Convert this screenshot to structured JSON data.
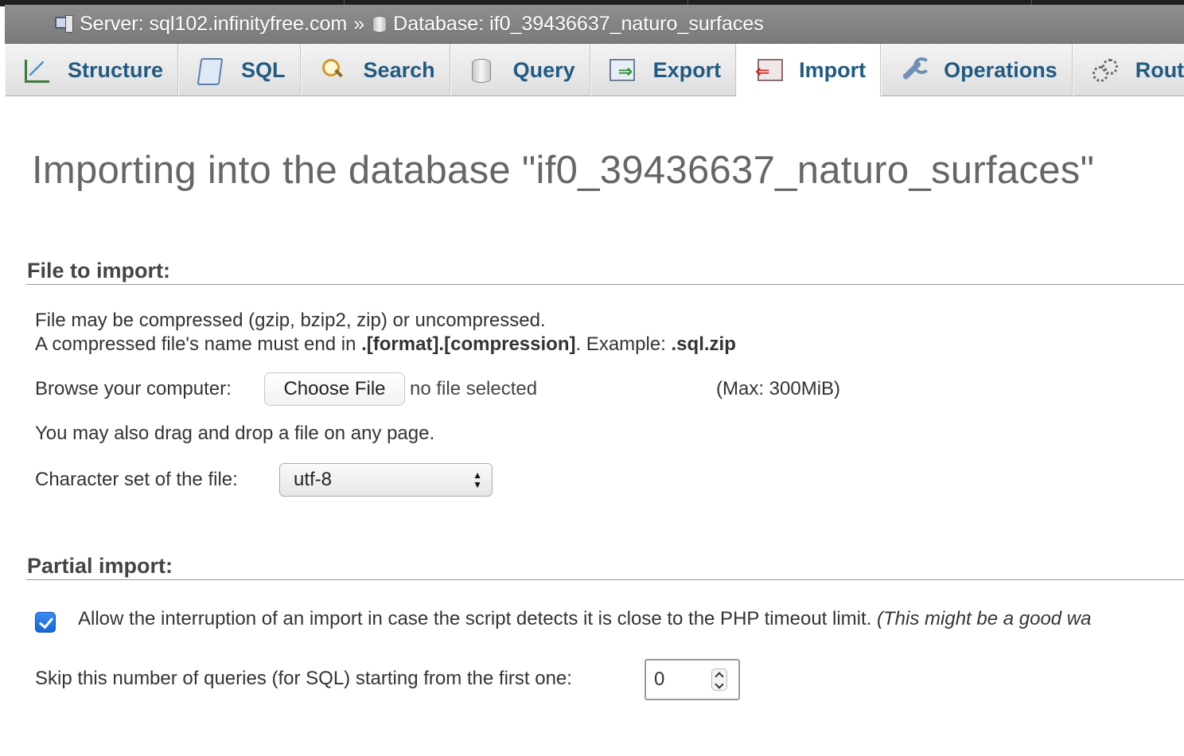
{
  "breadcrumb": {
    "server_label": "Server: sql102.infinityfree.com",
    "separator": "»",
    "database_label": "Database: if0_39436637_naturo_surfaces"
  },
  "tabs": [
    {
      "label": "Structure",
      "icon": "structure-icon",
      "active": false
    },
    {
      "label": "SQL",
      "icon": "sql-icon",
      "active": false
    },
    {
      "label": "Search",
      "icon": "search-icon",
      "active": false
    },
    {
      "label": "Query",
      "icon": "query-icon",
      "active": false
    },
    {
      "label": "Export",
      "icon": "export-icon",
      "active": false
    },
    {
      "label": "Import",
      "icon": "import-icon",
      "active": true
    },
    {
      "label": "Operations",
      "icon": "operations-icon",
      "active": false
    },
    {
      "label": "Routines",
      "icon": "routines-icon",
      "active": false
    }
  ],
  "page_title": "Importing into the database \"if0_39436637_naturo_surfaces\"",
  "file_section": {
    "legend": "File to import:",
    "line1": "File may be compressed (gzip, bzip2, zip) or uncompressed.",
    "line2_prefix": "A compressed file's name must end in ",
    "line2_format": ".[format].[compression]",
    "line2_middle": ". Example: ",
    "line2_example": ".sql.zip",
    "browse_label": "Browse your computer:",
    "choose_button": "Choose File",
    "no_file": "no file selected",
    "max_size": "(Max: 300MiB)",
    "drag_note": "You may also drag and drop a file on any page.",
    "charset_label": "Character set of the file:",
    "charset_value": "utf-8"
  },
  "partial_section": {
    "legend": "Partial import:",
    "allow_interrupt_checked": true,
    "allow_interrupt_label": "Allow the interruption of an import in case the script detects it is close to the PHP timeout limit. ",
    "allow_interrupt_note": "(This might be a good wa",
    "skip_label": "Skip this number of queries (for SQL) starting from the first one:",
    "skip_value": "0"
  },
  "colors": {
    "tab_text": "#235a81",
    "breadcrumb_bg": "#888888",
    "checkbox": "#1a73e8"
  }
}
